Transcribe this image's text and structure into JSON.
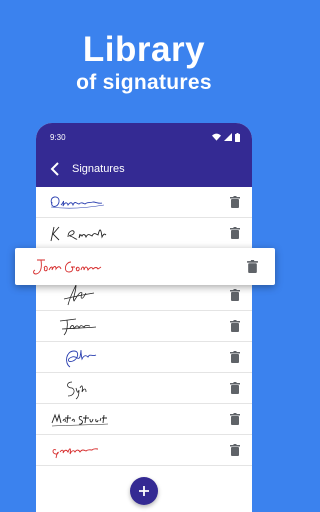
{
  "hero": {
    "title": "Library",
    "subtitle": "of signatures"
  },
  "status_bar": {
    "time": "9:30",
    "icons": [
      "wifi-icon",
      "cellular-signal-icon",
      "battery-icon"
    ]
  },
  "app_bar": {
    "title": "Signatures",
    "back_icon": "chevron-left-icon"
  },
  "signatures": [
    {
      "label": "Olivera",
      "color": "#2a3fb0"
    },
    {
      "label": "K Richard",
      "color": "#222222"
    },
    {
      "label": "Joan Gomez",
      "color": "#d62a2a",
      "highlighted": true
    },
    {
      "label": "signature",
      "color": "#222222"
    },
    {
      "label": "signature",
      "color": "#222222"
    },
    {
      "label": "signature",
      "color": "#2a3fb0"
    },
    {
      "label": "signature",
      "color": "#222222"
    },
    {
      "label": "Mata Stuart",
      "color": "#222222"
    },
    {
      "label": "Gutierrez",
      "color": "#d62a2a"
    }
  ],
  "actions": {
    "delete_icon": "trash-icon",
    "add_icon": "plus-icon"
  },
  "colors": {
    "background": "#3b82ee",
    "app_bar": "#342a93",
    "delete_icon": "#5f6368"
  }
}
